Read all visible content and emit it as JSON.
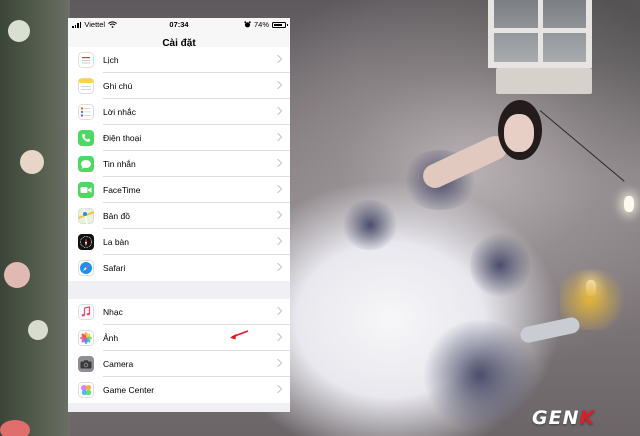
{
  "status_bar": {
    "carrier": "Viettel",
    "time": "07:34",
    "battery": "74%"
  },
  "nav": {
    "title": "Cài đặt"
  },
  "groups": [
    {
      "items": [
        {
          "label": "Lịch",
          "icon": "calendar-icon"
        },
        {
          "label": "Ghi chú",
          "icon": "notes-icon"
        },
        {
          "label": "Lời nhắc",
          "icon": "reminders-icon"
        },
        {
          "label": "Điện thoại",
          "icon": "phone-icon"
        },
        {
          "label": "Tin nhắn",
          "icon": "messages-icon"
        },
        {
          "label": "FaceTime",
          "icon": "facetime-icon"
        },
        {
          "label": "Bản đồ",
          "icon": "maps-icon"
        },
        {
          "label": "La bàn",
          "icon": "compass-icon"
        },
        {
          "label": "Safari",
          "icon": "safari-icon"
        }
      ]
    },
    {
      "items": [
        {
          "label": "Nhạc",
          "icon": "music-icon"
        },
        {
          "label": "Ảnh",
          "icon": "photos-icon",
          "annotated": true
        },
        {
          "label": "Camera",
          "icon": "camera-icon"
        },
        {
          "label": "Game Center",
          "icon": "game-center-icon"
        }
      ]
    }
  ],
  "annotation_color": "#e0171f",
  "logo": {
    "text_main": "GEN",
    "text_accent": "K",
    "accent_color": "#e01c25"
  }
}
